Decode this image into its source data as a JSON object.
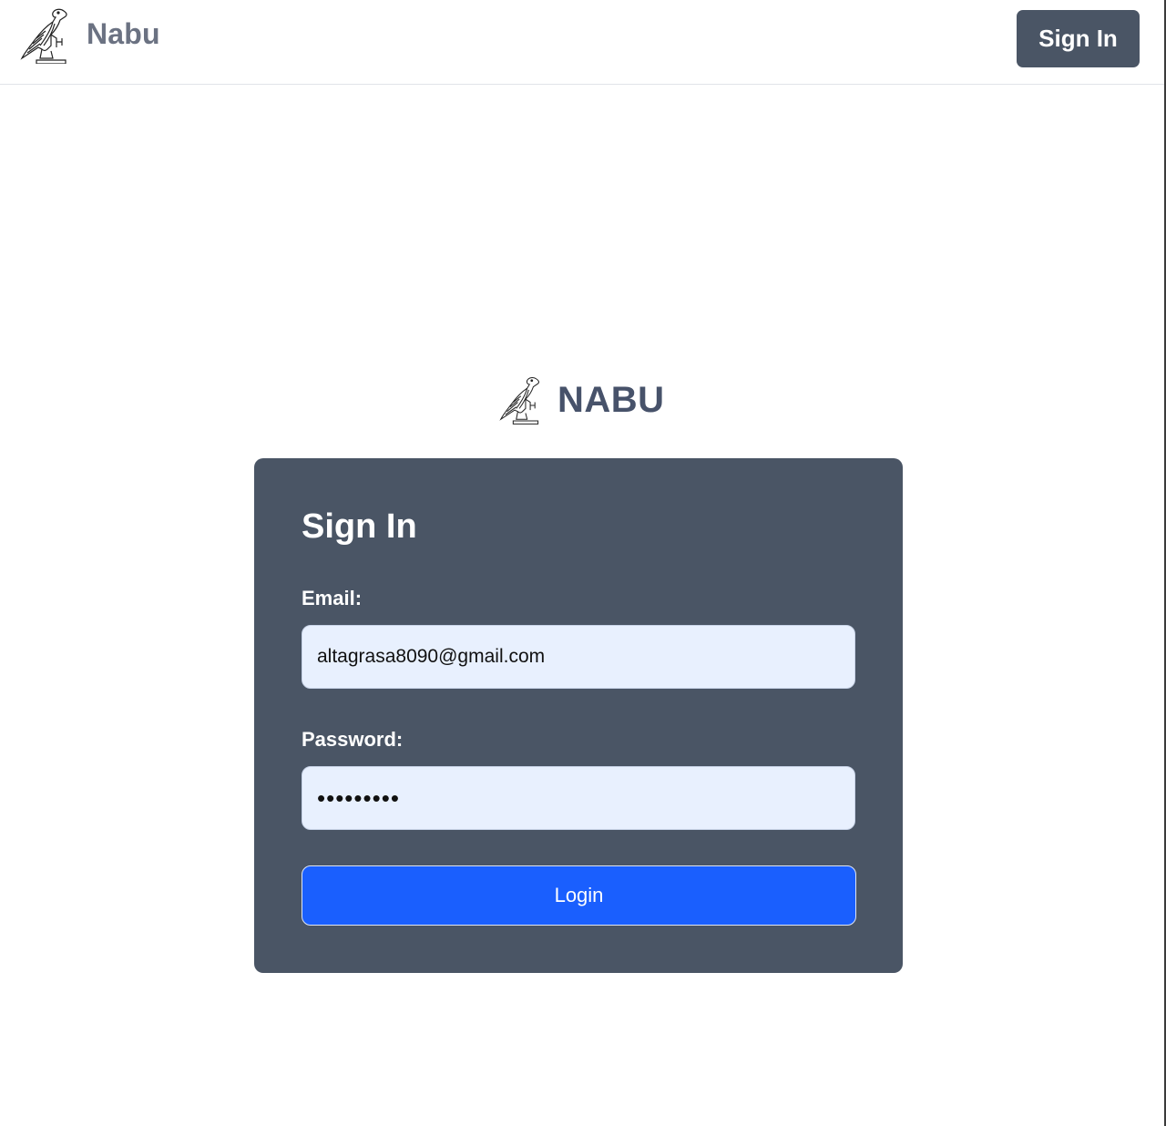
{
  "header": {
    "brand_name": "Nabu",
    "logo_icon": "falcon-icon",
    "signin_label": "Sign In"
  },
  "center": {
    "brand_name": "NABU",
    "logo_icon": "falcon-icon"
  },
  "form": {
    "title": "Sign In",
    "email_label": "Email:",
    "email_value": "altagrasa8090@gmail.com",
    "password_label": "Password:",
    "password_value": "•••••••••",
    "login_label": "Login"
  },
  "colors": {
    "card_bg": "#4a5565",
    "button_primary": "#1a5ffe",
    "input_bg": "#e8f0fe",
    "brand_text": "#6b7282"
  }
}
